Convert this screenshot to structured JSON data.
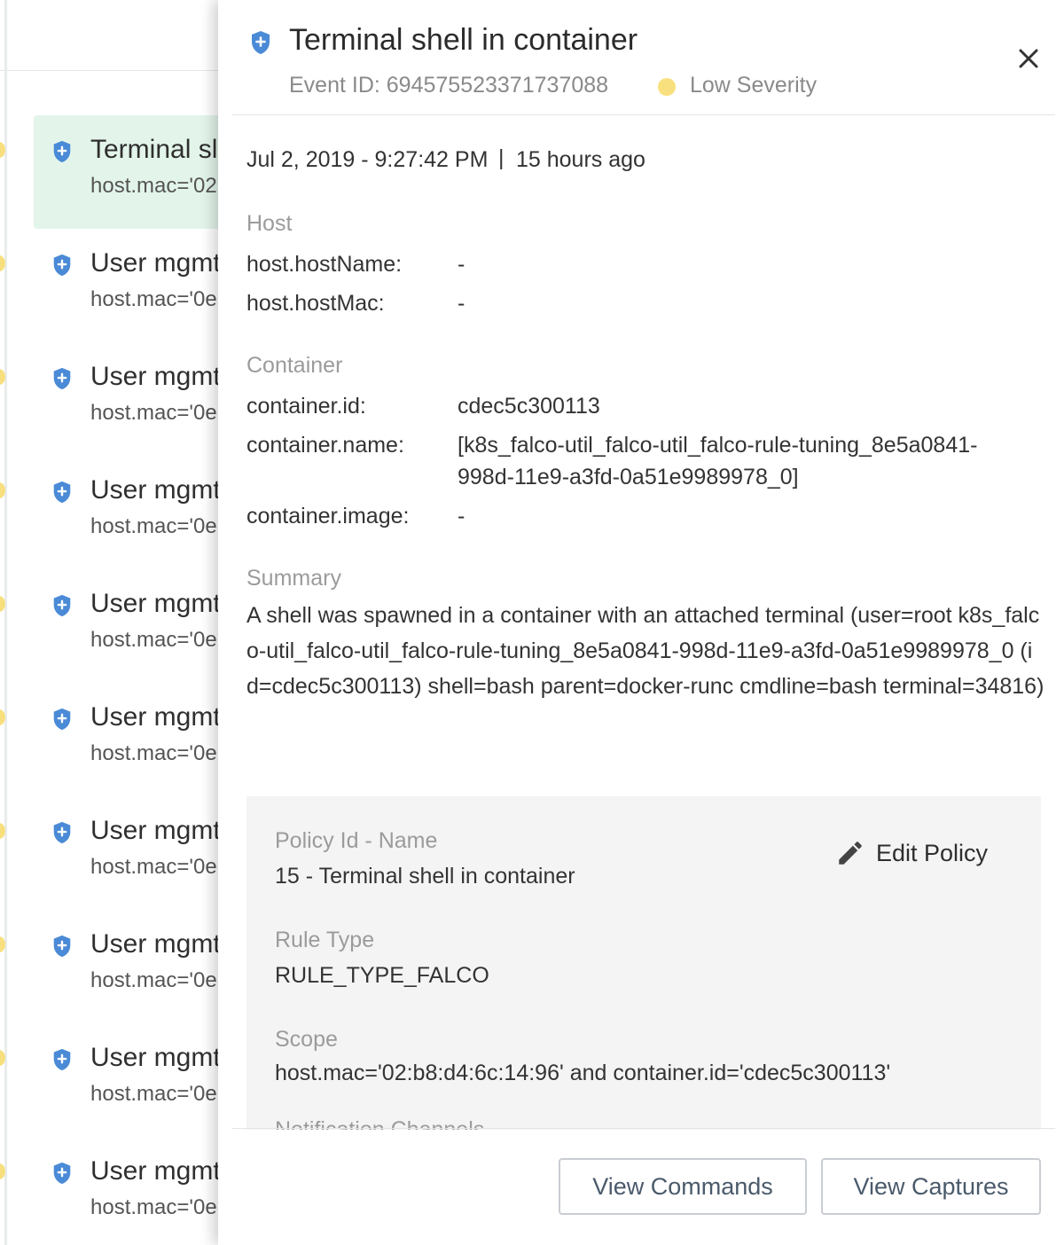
{
  "event_list": {
    "items": [
      {
        "title": "Terminal sl",
        "subtitle": "host.mac='02",
        "active": true
      },
      {
        "title": "User mgmt",
        "subtitle": "host.mac='0e",
        "active": false
      },
      {
        "title": "User mgmt",
        "subtitle": "host.mac='0e",
        "active": false
      },
      {
        "title": "User mgmt",
        "subtitle": "host.mac='0e",
        "active": false
      },
      {
        "title": "User mgmt",
        "subtitle": "host.mac='0e",
        "active": false
      },
      {
        "title": "User mgmt",
        "subtitle": "host.mac='0e",
        "active": false
      },
      {
        "title": "User mgmt",
        "subtitle": "host.mac='0e",
        "active": false
      },
      {
        "title": "User mgmt",
        "subtitle": "host.mac='0e",
        "active": false
      },
      {
        "title": "User mgmt",
        "subtitle": "host.mac='0e",
        "active": false
      },
      {
        "title": "User mgmt",
        "subtitle": "host.mac='0e",
        "active": false
      }
    ],
    "dot_color": "#f7df7e",
    "active_color": "#e3f5ea"
  },
  "detail": {
    "title": "Terminal shell in container",
    "event_id": "Event ID: 694575523371737088",
    "severity": "Low Severity",
    "severity_color": "#f9e07f",
    "timestamp": "Jul 2, 2019 - 9:27:42 PM",
    "separator": "|",
    "relative_time": "15 hours ago",
    "host": {
      "label": "Host",
      "host_name_key": "host.hostName:",
      "host_name_value": "-",
      "host_mac_key": "host.hostMac:",
      "host_mac_value": "-"
    },
    "container": {
      "label": "Container",
      "id_key": "container.id:",
      "id_value": "cdec5c300113",
      "name_key": "container.name:",
      "name_value_line1": "[k8s_falco-util_falco-util_falco-rule-tuning_8e5a0841-",
      "name_value_line2": "998d-11e9-a3fd-0a51e9989978_0]",
      "image_key": "container.image:",
      "image_value": "-"
    },
    "summary": {
      "label": "Summary",
      "text": "A shell was spawned in a container with an attached terminal (user=root k8s_falco-util_falco-util_falco-rule-tuning_8e5a0841-998d-11e9-a3fd-0a51e9989978_0 (id=cdec5c300113) shell=bash parent=docker-runc cmdline=bash terminal=34816)"
    },
    "policy": {
      "id_name_label": "Policy Id - Name",
      "id_name_value": "15 - Terminal shell in container",
      "edit_label": "Edit Policy",
      "rule_type_label": "Rule Type",
      "rule_type_value": "RULE_TYPE_FALCO",
      "scope_label": "Scope",
      "scope_value": "host.mac='02:b8:d4:6c:14:96' and container.id='cdec5c300113'",
      "notification_label": "Notification Channels"
    },
    "footer": {
      "view_commands": "View Commands",
      "view_captures": "View Captures"
    }
  },
  "colors": {
    "shield_blue": "#4a8ad6",
    "panel_bg_gray": "#f4f4f4"
  }
}
